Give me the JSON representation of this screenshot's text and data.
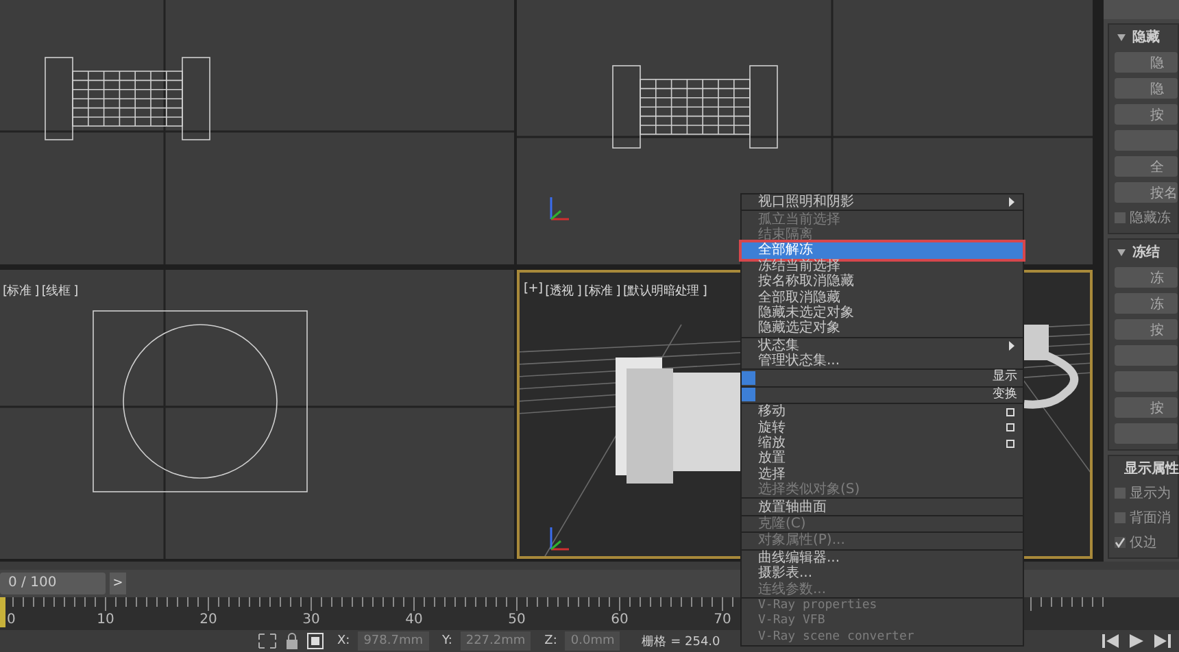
{
  "viewports": [
    {
      "kind": "front",
      "active": false
    },
    {
      "kind": "top",
      "active": false
    },
    {
      "kind": "left",
      "active": false,
      "labels": [
        "[标准 ]",
        "[线框 ]"
      ]
    },
    {
      "kind": "perspective",
      "active": true,
      "labels": [
        "[+]",
        "[透视 ]",
        "[标准 ]",
        "[默认明暗处理 ]"
      ]
    }
  ],
  "command_panel": {
    "sections": [
      {
        "title": "隐藏",
        "items": [
          {
            "kind": "button",
            "label": "隐"
          },
          {
            "kind": "button",
            "label": "隐"
          },
          {
            "kind": "button",
            "label": "按"
          },
          {
            "kind": "blank"
          },
          {
            "kind": "button",
            "label": "全"
          },
          {
            "kind": "button",
            "label": "按名"
          },
          {
            "kind": "checkbox",
            "label": "隐藏冻",
            "checked": false
          }
        ]
      },
      {
        "title": "冻结",
        "items": [
          {
            "kind": "button",
            "label": "冻"
          },
          {
            "kind": "button",
            "label": "冻"
          },
          {
            "kind": "button",
            "label": "按"
          },
          {
            "kind": "blank"
          },
          {
            "kind": "blank"
          },
          {
            "kind": "button",
            "label": "按"
          },
          {
            "kind": "blank"
          }
        ]
      },
      {
        "title": "显示属性",
        "items": [
          {
            "kind": "checkbox",
            "label": "显示为",
            "checked": false
          },
          {
            "kind": "checkbox",
            "label": "背面消",
            "checked": false
          },
          {
            "kind": "checkbox",
            "label": "仅边",
            "checked": true
          }
        ]
      }
    ]
  },
  "timeline": {
    "frame_counter": "0 / 100",
    "next_button": ">",
    "ruler_labels": [
      "0",
      "10",
      "20",
      "30",
      "40",
      "50",
      "60",
      "70"
    ]
  },
  "status_bar": {
    "coords": [
      {
        "axis": "X:",
        "value": "978.7mm"
      },
      {
        "axis": "Y:",
        "value": "227.2mm"
      },
      {
        "axis": "Z:",
        "value": "0.0mm"
      }
    ],
    "grid": "栅格 = 254.0"
  },
  "context_menu": {
    "items": [
      {
        "kind": "submenu",
        "label": "视口照明和阴影",
        "disabled": false,
        "selected": false
      },
      {
        "kind": "separator"
      },
      {
        "kind": "item",
        "label": "孤立当前选择",
        "disabled": true,
        "selected": false
      },
      {
        "kind": "item",
        "label": "结束隔离",
        "disabled": true,
        "selected": false
      },
      {
        "kind": "item",
        "label": "全部解冻",
        "disabled": false,
        "selected": true,
        "annotated": true
      },
      {
        "kind": "item",
        "label": "冻结当前选择",
        "disabled": false,
        "selected": false
      },
      {
        "kind": "item",
        "label": "按名称取消隐藏",
        "disabled": false,
        "selected": false
      },
      {
        "kind": "item",
        "label": "全部取消隐藏",
        "disabled": false,
        "selected": false
      },
      {
        "kind": "item",
        "label": "隐藏未选定对象",
        "disabled": false,
        "selected": false
      },
      {
        "kind": "item",
        "label": "隐藏选定对象",
        "disabled": false,
        "selected": false
      },
      {
        "kind": "separator"
      },
      {
        "kind": "submenu",
        "label": "状态集",
        "disabled": false,
        "selected": false
      },
      {
        "kind": "item",
        "label": "管理状态集...",
        "disabled": false,
        "selected": false
      },
      {
        "kind": "separator"
      },
      {
        "kind": "quad-header",
        "label": "显示"
      },
      {
        "kind": "separator"
      },
      {
        "kind": "quad-header",
        "label": "变换"
      },
      {
        "kind": "separator"
      },
      {
        "kind": "option",
        "label": "移动",
        "disabled": false,
        "selected": false
      },
      {
        "kind": "option",
        "label": "旋转",
        "disabled": false,
        "selected": false
      },
      {
        "kind": "option",
        "label": "缩放",
        "disabled": false,
        "selected": false
      },
      {
        "kind": "item",
        "label": "放置",
        "disabled": false,
        "selected": false
      },
      {
        "kind": "item",
        "label": "选择",
        "disabled": false,
        "selected": false
      },
      {
        "kind": "item",
        "label": "选择类似对象(S)",
        "disabled": true,
        "selected": false
      },
      {
        "kind": "separator"
      },
      {
        "kind": "item",
        "label": "放置轴曲面",
        "disabled": false,
        "selected": false
      },
      {
        "kind": "separator"
      },
      {
        "kind": "item",
        "label": "克隆(C)",
        "disabled": true,
        "selected": false
      },
      {
        "kind": "separator"
      },
      {
        "kind": "item",
        "label": "对象属性(P)...",
        "disabled": true,
        "selected": false
      },
      {
        "kind": "separator"
      },
      {
        "kind": "item",
        "label": "曲线编辑器...",
        "disabled": false,
        "selected": false
      },
      {
        "kind": "item",
        "label": "摄影表...",
        "disabled": false,
        "selected": false
      },
      {
        "kind": "item",
        "label": "连线参数...",
        "disabled": true,
        "selected": false
      },
      {
        "kind": "separator"
      },
      {
        "kind": "mono",
        "label": "V-Ray properties",
        "disabled": true,
        "selected": false
      },
      {
        "kind": "mono",
        "label": "V-Ray VFB",
        "disabled": true,
        "selected": false
      },
      {
        "kind": "mono",
        "label": "V-Ray scene converter",
        "disabled": true,
        "selected": false
      }
    ]
  }
}
